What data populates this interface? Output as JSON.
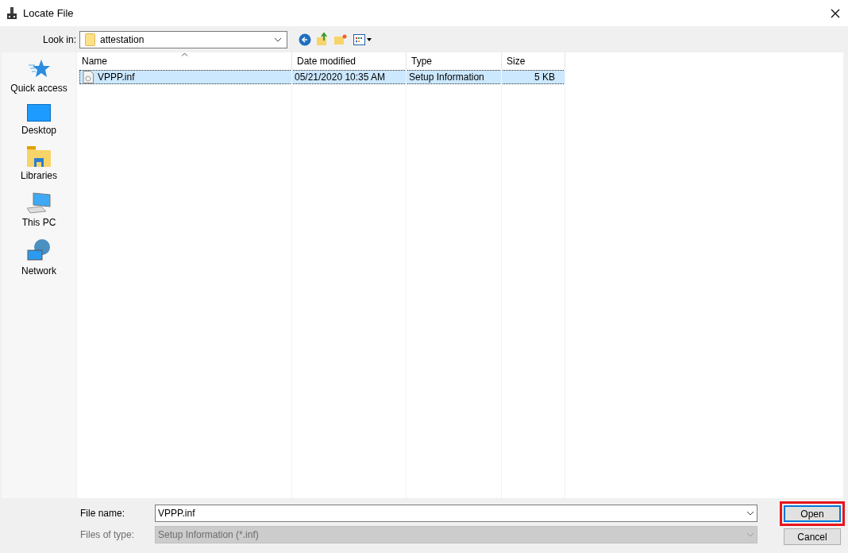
{
  "window": {
    "title": "Locate File"
  },
  "look_in": {
    "label": "Look in:",
    "value": "attestation"
  },
  "sidebar": {
    "items": [
      {
        "label": "Quick access",
        "kind": "star"
      },
      {
        "label": "Desktop",
        "kind": "desktop"
      },
      {
        "label": "Libraries",
        "kind": "libraries"
      },
      {
        "label": "This PC",
        "kind": "pc"
      },
      {
        "label": "Network",
        "kind": "network"
      }
    ]
  },
  "table": {
    "columns": [
      {
        "label": "Name",
        "sorted": true
      },
      {
        "label": "Date modified",
        "sorted": false
      },
      {
        "label": "Type",
        "sorted": false
      },
      {
        "label": "Size",
        "sorted": false
      }
    ],
    "rows": [
      {
        "cells": [
          "VPPP.inf",
          "05/21/2020 10:35 AM",
          "Setup Information",
          "5 KB"
        ],
        "selected": true
      }
    ]
  },
  "file_name": {
    "label": "File name:",
    "value": "VPPP.inf",
    "disabled": false
  },
  "file_type": {
    "label": "Files of type:",
    "value": "Setup Information (*.inf)",
    "disabled": true
  },
  "buttons": [
    {
      "label": "Open",
      "highlighted": true
    },
    {
      "label": "Cancel",
      "highlighted": false
    }
  ]
}
